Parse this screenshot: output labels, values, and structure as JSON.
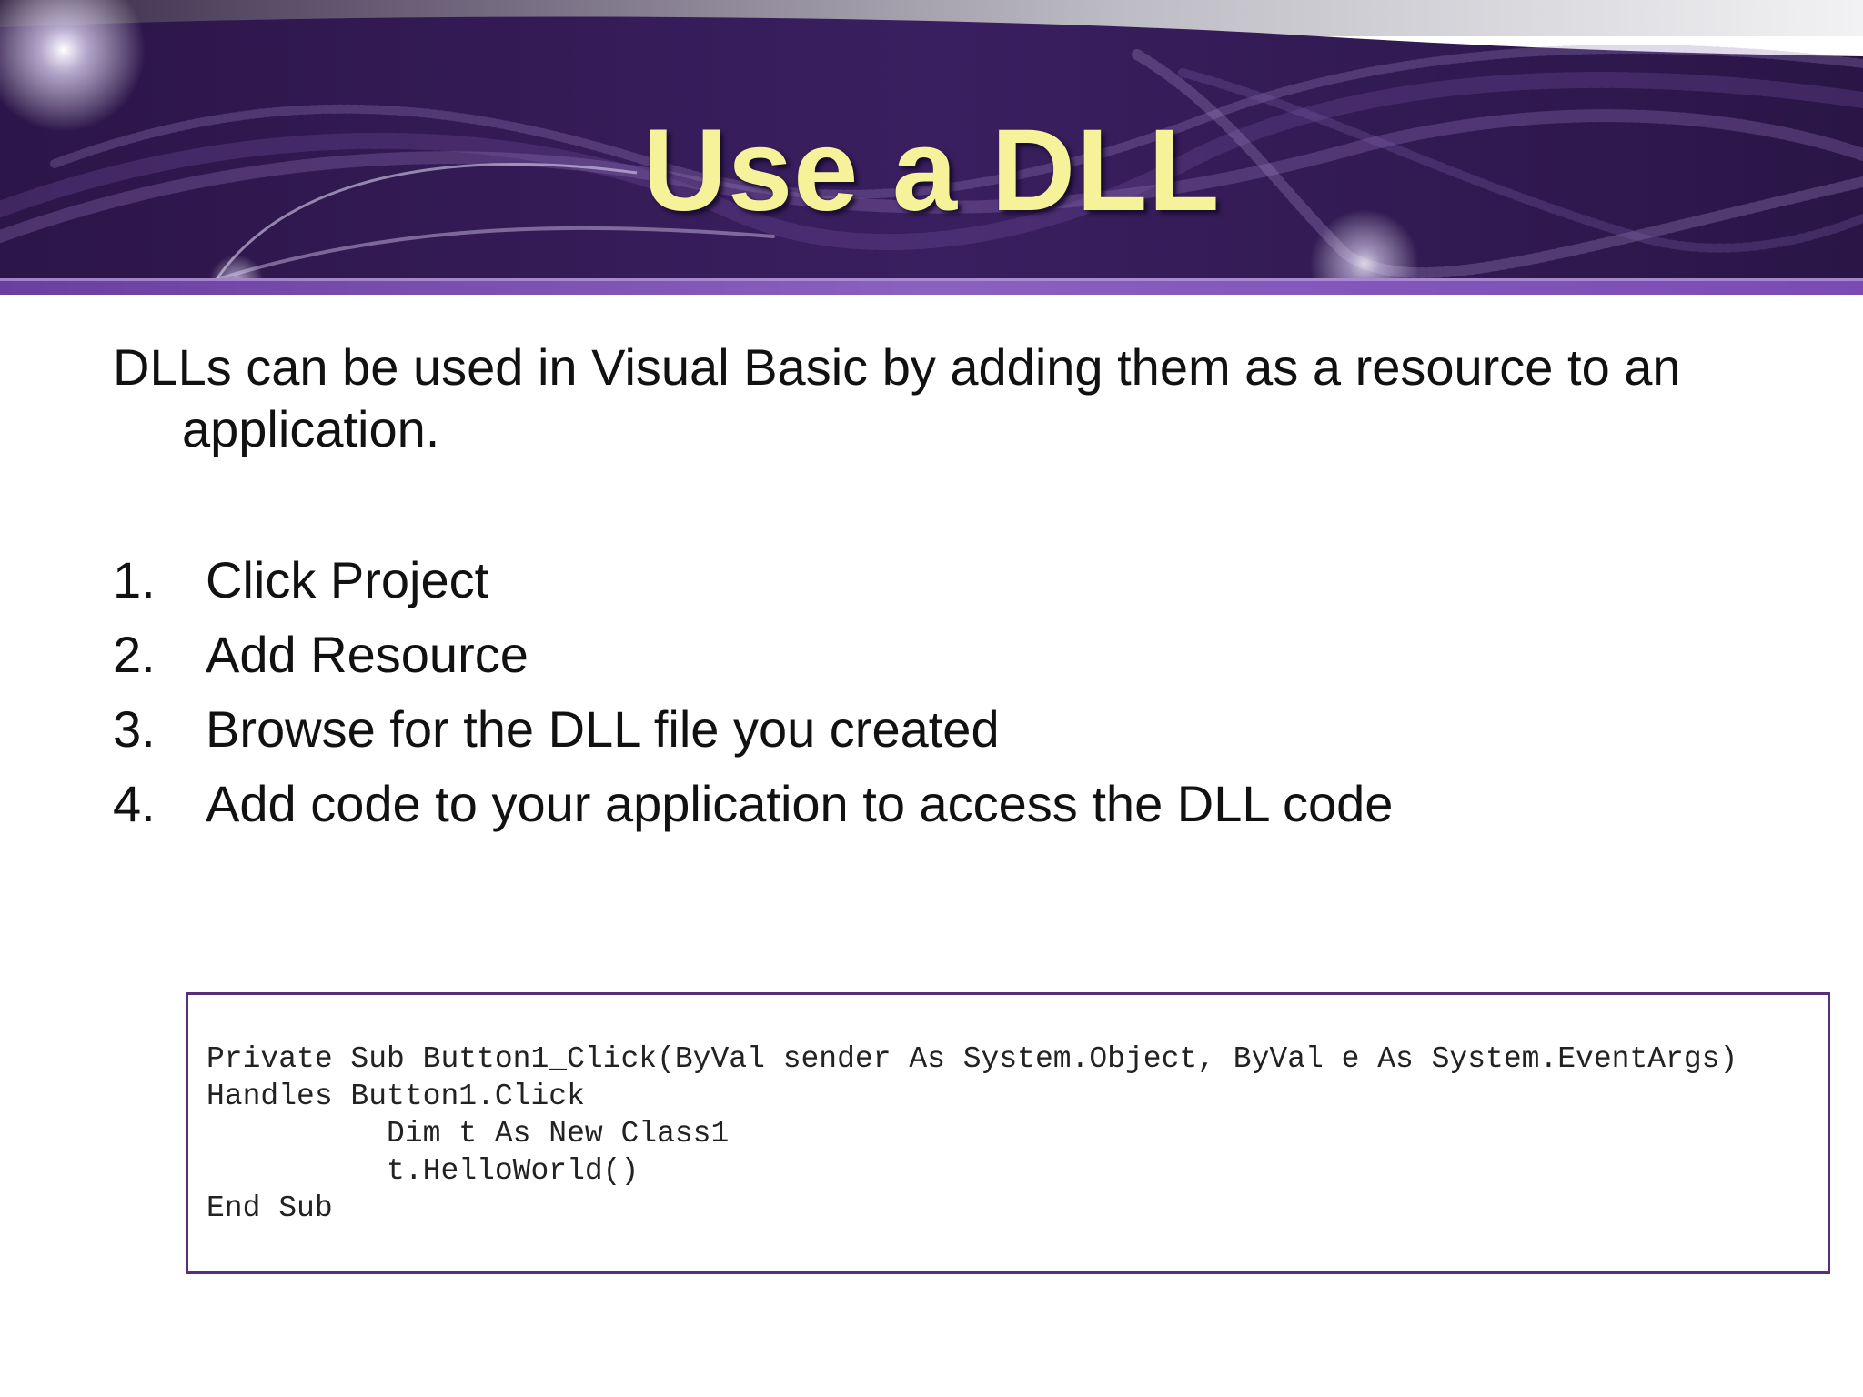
{
  "slide": {
    "title": "Use a DLL",
    "intro": "DLLs can be used in Visual Basic by adding them as a resource to an application.",
    "steps": [
      {
        "number": "1.",
        "text": "Click Project"
      },
      {
        "number": "2.",
        "text": "Add Resource"
      },
      {
        "number": "3.",
        "text": "Browse for the DLL file you created"
      },
      {
        "number": "4.",
        "text": "Add code to your application to access the DLL code"
      }
    ],
    "code": "Private Sub Button1_Click(ByVal sender As System.Object, ByVal e As System.EventArgs)\nHandles Button1.Click\n          Dim t As New Class1\n          t.HelloWorld()\nEnd Sub"
  },
  "colors": {
    "banner_dark": "#2a1548",
    "banner_mid": "#3b1f63",
    "banner_band": "#7a4fb0",
    "title_yellow": "#f5f29a",
    "code_border": "#5a2d7a"
  }
}
